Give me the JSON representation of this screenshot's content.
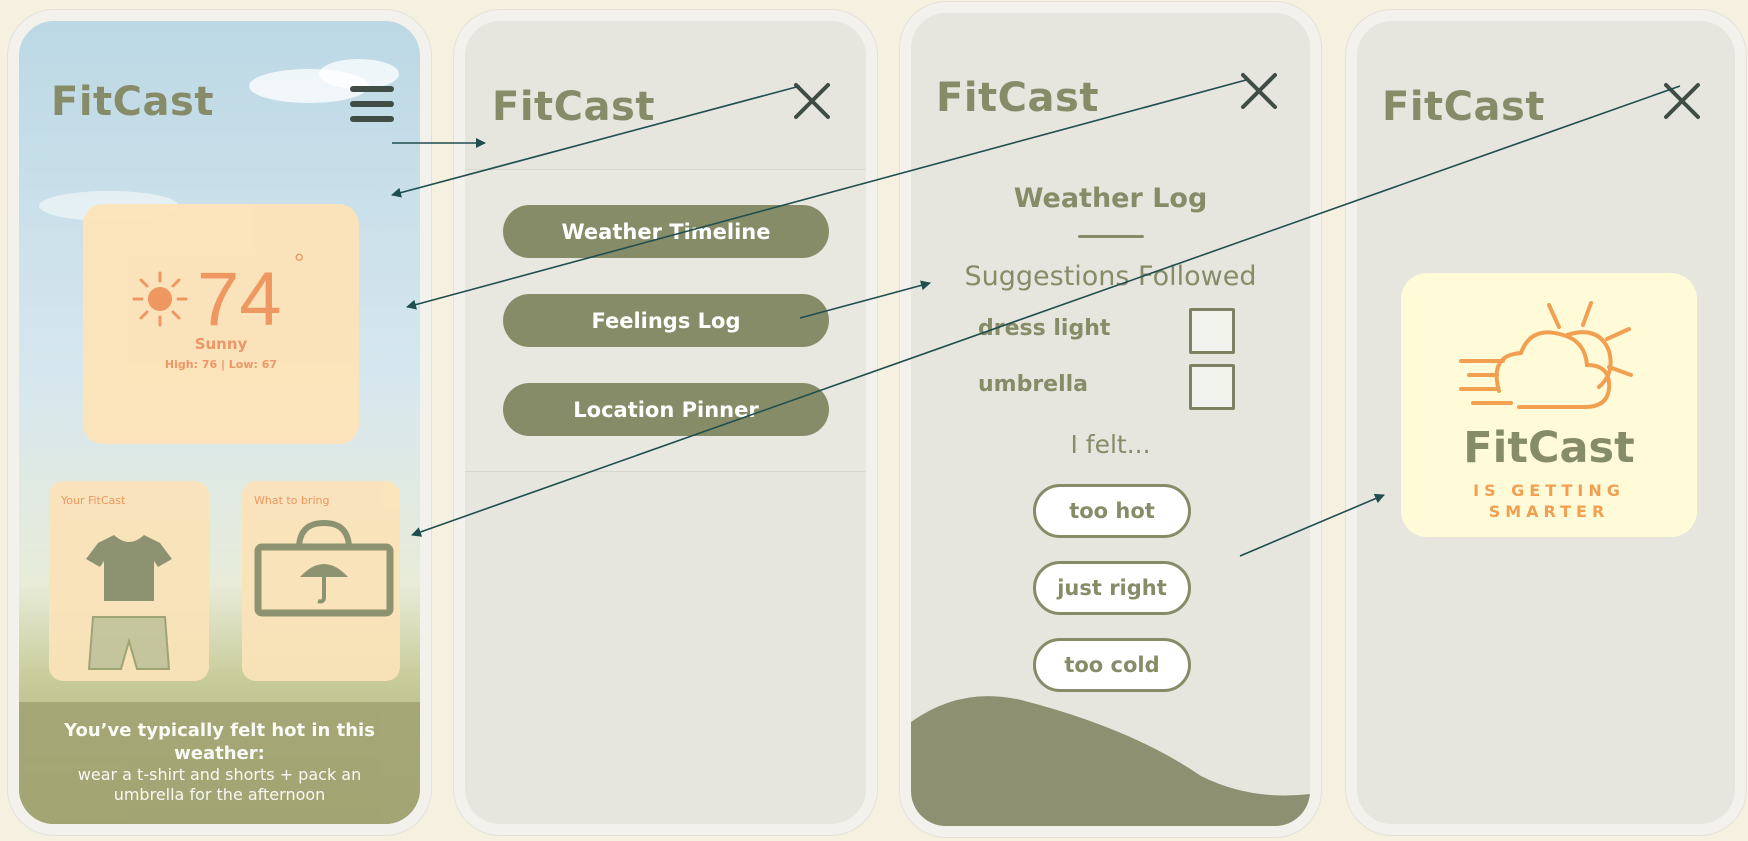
{
  "app": {
    "brand": "FitCast"
  },
  "home": {
    "temperature": "74",
    "degree": "°",
    "condition": "Sunny",
    "high_low": "High: 76 | Low: 67",
    "outfit_label": "Your FitCast",
    "bring_label": "What to bring",
    "tip_headline": "You’ve typically felt hot in this weather:",
    "tip_body": "wear a t-shirt and shorts + pack an umbrella for the afternoon",
    "icons": [
      "menu-icon",
      "sun-icon",
      "tshirt-icon",
      "shorts-icon",
      "bag-umbrella-icon"
    ]
  },
  "menu": {
    "items": [
      {
        "label": "Weather Timeline"
      },
      {
        "label": "Feelings Log"
      },
      {
        "label": "Location Pinner"
      }
    ]
  },
  "log": {
    "title": "Weather Log",
    "subtitle": "Suggestions Followed",
    "suggestions": [
      {
        "label": "dress light",
        "checked": false
      },
      {
        "label": "umbrella",
        "checked": false
      }
    ],
    "felt_prompt": "I felt...",
    "options": [
      "too hot",
      "just right",
      "too cold"
    ]
  },
  "splash": {
    "brand": "FitCast",
    "tagline_1": "IS GETTING",
    "tagline_2": "SMARTER"
  },
  "colors": {
    "olive": "#868c68",
    "accent_orange": "#f0935a",
    "card_peach": "#fde3b8",
    "canvas": "#f6f0e0",
    "screen": "#e6e6df",
    "arrow": "#1f4e4e"
  }
}
